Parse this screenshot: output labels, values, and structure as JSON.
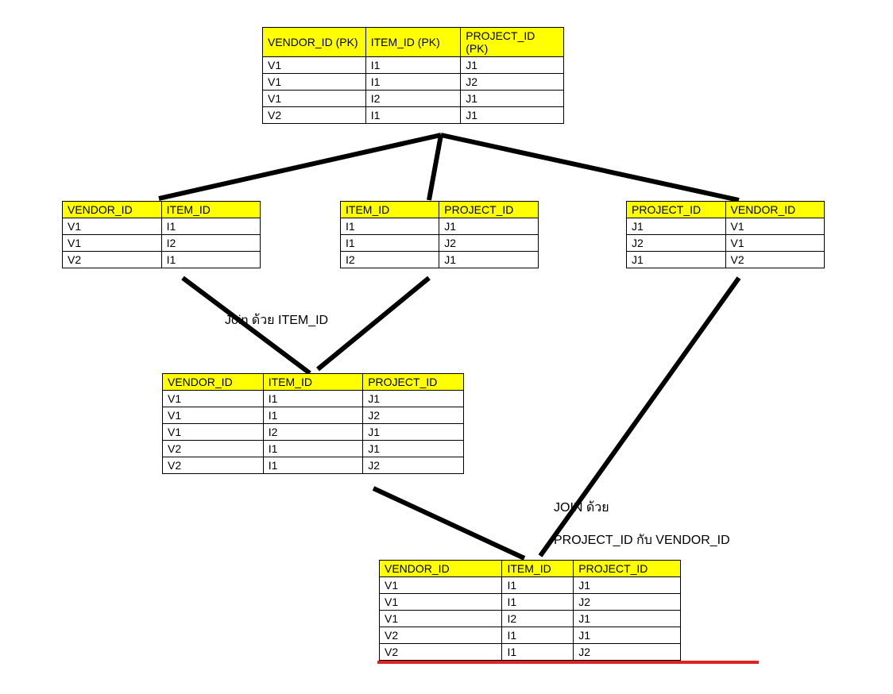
{
  "tables": {
    "top": {
      "headers": [
        "VENDOR_ID (PK)",
        "ITEM_ID (PK)",
        "PROJECT_ID (PK)"
      ],
      "rows": [
        [
          "V1",
          "I1",
          "J1"
        ],
        [
          "V1",
          "I1",
          "J2"
        ],
        [
          "V1",
          "I2",
          "J1"
        ],
        [
          "V2",
          "I1",
          "J1"
        ]
      ]
    },
    "left": {
      "headers": [
        "VENDOR_ID",
        "ITEM_ID"
      ],
      "rows": [
        [
          "V1",
          "I1"
        ],
        [
          "V1",
          "I2"
        ],
        [
          "V2",
          "I1"
        ]
      ]
    },
    "mid": {
      "headers": [
        "ITEM_ID",
        "PROJECT_ID"
      ],
      "rows": [
        [
          "I1",
          "J1"
        ],
        [
          "I1",
          "J2"
        ],
        [
          "I2",
          "J1"
        ]
      ]
    },
    "right": {
      "headers": [
        "PROJECT_ID",
        "VENDOR_ID"
      ],
      "rows": [
        [
          "J1",
          "V1"
        ],
        [
          "J2",
          "V1"
        ],
        [
          "J1",
          "V2"
        ]
      ]
    },
    "join1": {
      "headers": [
        "VENDOR_ID",
        "ITEM_ID",
        "PROJECT_ID"
      ],
      "rows": [
        [
          "V1",
          "I1",
          "J1"
        ],
        [
          "V1",
          "I1",
          "J2"
        ],
        [
          "V1",
          "I2",
          "J1"
        ],
        [
          "V2",
          "I1",
          "J1"
        ],
        [
          "V2",
          "I1",
          "J2"
        ]
      ]
    },
    "join2": {
      "headers": [
        "VENDOR_ID",
        "ITEM_ID",
        "PROJECT_ID"
      ],
      "rows": [
        [
          "V1",
          "I1",
          "J1"
        ],
        [
          "V1",
          "I1",
          "J2"
        ],
        [
          "V1",
          "I2",
          "J1"
        ],
        [
          "V2",
          "I1",
          "J1"
        ],
        [
          "V2",
          "I1",
          "J2"
        ]
      ]
    }
  },
  "labels": {
    "join_item": "Join ด้วย ITEM_ID",
    "join_proj1": "JOIN ด้วย",
    "join_proj2": "PROJECT_ID กับ VENDOR_ID"
  }
}
